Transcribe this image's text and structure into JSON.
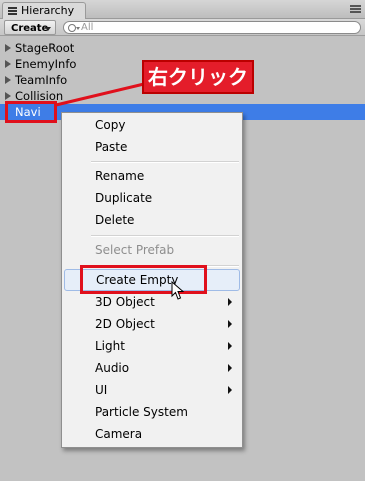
{
  "window": {
    "tab_label": "Hierarchy"
  },
  "toolbar": {
    "create_label": "Create",
    "search_placeholder": "All"
  },
  "hierarchy": {
    "items": [
      {
        "label": "StageRoot",
        "has_children": true
      },
      {
        "label": "EnemyInfo",
        "has_children": true
      },
      {
        "label": "TeamInfo",
        "has_children": true
      },
      {
        "label": "Collision",
        "has_children": true
      },
      {
        "label": "Navi",
        "has_children": false,
        "selected": true
      }
    ]
  },
  "context_menu": {
    "items": [
      {
        "label": "Copy"
      },
      {
        "label": "Paste"
      },
      {
        "label": "Rename"
      },
      {
        "label": "Duplicate"
      },
      {
        "label": "Delete"
      },
      {
        "label": "Select Prefab",
        "disabled": true
      },
      {
        "label": "Create Empty",
        "highlighted": true
      },
      {
        "label": "3D Object",
        "submenu": true
      },
      {
        "label": "2D Object",
        "submenu": true
      },
      {
        "label": "Light",
        "submenu": true
      },
      {
        "label": "Audio",
        "submenu": true
      },
      {
        "label": "UI",
        "submenu": true
      },
      {
        "label": "Particle System"
      },
      {
        "label": "Camera"
      }
    ]
  },
  "annotation": {
    "callout_text": "右クリック",
    "color": "#e0101c"
  },
  "colors": {
    "selection": "#3e7de7",
    "panel_bg": "#c2c2c2",
    "menu_bg": "#f1f1f1"
  }
}
